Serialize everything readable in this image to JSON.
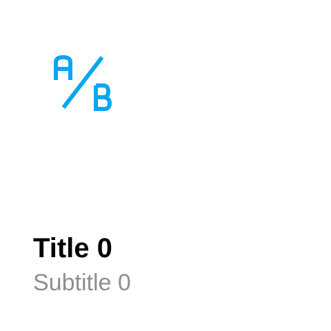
{
  "card": {
    "icon": "ab-test-icon",
    "title": "Title 0",
    "subtitle": "Subtitle 0"
  },
  "colors": {
    "accent": "#0aa7f0",
    "title": "#000000",
    "subtitle": "#8e8e93",
    "background": "#ffffff"
  }
}
